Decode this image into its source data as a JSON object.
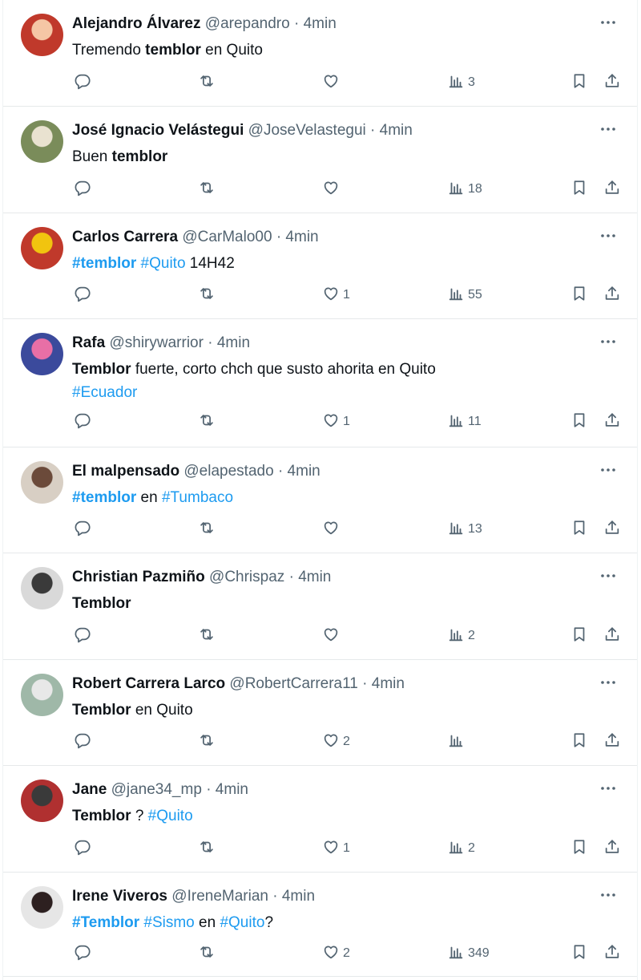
{
  "colors": {
    "accent": "#1d9bf0",
    "muted": "#536471",
    "text": "#0f1419",
    "border": "#e6e9ea"
  },
  "icons": {
    "reply": "speech-bubble-icon",
    "retweet": "retweet-arrows-icon",
    "like": "heart-icon",
    "views": "bar-chart-icon",
    "bookmark": "bookmark-icon",
    "share": "share-upload-icon",
    "more": "more-dots-icon"
  },
  "tweets": [
    {
      "name": "Alejandro Álvarez",
      "handle": "@arepandro",
      "dot": "·",
      "time": "4min",
      "text": [
        {
          "t": "Tremendo "
        },
        {
          "t": "temblor",
          "b": true
        },
        {
          "t": " en Quito"
        }
      ],
      "likes": "",
      "views": "3",
      "avatar": [
        "#c0392b",
        "#f5c6a5"
      ]
    },
    {
      "name": "José Ignacio Velástegui",
      "handle": "@JoseVelastegui",
      "dot": "·",
      "time": "4min",
      "text": [
        {
          "t": "Buen "
        },
        {
          "t": "temblor",
          "b": true
        }
      ],
      "likes": "",
      "views": "18",
      "avatar": [
        "#7a8c5a",
        "#e9e2d0"
      ]
    },
    {
      "name": "Carlos Carrera",
      "handle": "@CarMalo00",
      "dot": "·",
      "time": "4min",
      "text": [
        {
          "t": "#temblor",
          "h": true,
          "b": true
        },
        {
          "t": " "
        },
        {
          "t": "#Quito",
          "h": true
        },
        {
          "t": " 14H42"
        }
      ],
      "likes": "1",
      "views": "55",
      "avatar": [
        "#c0392b",
        "#f1c40f"
      ]
    },
    {
      "name": "Rafa",
      "handle": "@shirywarrior",
      "dot": "·",
      "time": "4min",
      "text": [
        {
          "t": "Temblor",
          "b": true
        },
        {
          "t": " fuerte, corto chch que susto ahorita en Quito "
        },
        {
          "t": "#Ecuador",
          "h": true
        }
      ],
      "likes": "1",
      "views": "11",
      "avatar": [
        "#3b4a9c",
        "#e86fa6"
      ]
    },
    {
      "name": "El malpensado",
      "handle": "@elapestado",
      "dot": "·",
      "time": "4min",
      "text": [
        {
          "t": "#temblor",
          "h": true,
          "b": true
        },
        {
          "t": " en "
        },
        {
          "t": "#Tumbaco",
          "h": true
        }
      ],
      "likes": "",
      "views": "13",
      "avatar": [
        "#d8cfc4",
        "#6b4a3a"
      ]
    },
    {
      "name": "Christian Pazmiño",
      "handle": "@Chrispaz",
      "dot": "·",
      "time": "4min",
      "text": [
        {
          "t": "Temblor",
          "b": true
        }
      ],
      "likes": "",
      "views": "2",
      "avatar": [
        "#d9d9d9",
        "#3a3a3a"
      ]
    },
    {
      "name": "Robert Carrera Larco",
      "handle": "@RobertCarrera11",
      "dot": "·",
      "time": "4min",
      "text": [
        {
          "t": "Temblor",
          "b": true
        },
        {
          "t": " en Quito"
        }
      ],
      "likes": "2",
      "views": "",
      "avatar": [
        "#9fb8a8",
        "#e8e8e8"
      ]
    },
    {
      "name": "Jane",
      "handle": "@jane34_mp",
      "dot": "·",
      "time": "4min",
      "text": [
        {
          "t": "Temblor",
          "b": true
        },
        {
          "t": " ? "
        },
        {
          "t": "#Quito",
          "h": true
        }
      ],
      "likes": "1",
      "views": "2",
      "avatar": [
        "#b03030",
        "#3a3a3a"
      ]
    },
    {
      "name": "Irene Viveros",
      "handle": "@IreneMarian",
      "dot": "·",
      "time": "4min",
      "text": [
        {
          "t": "#Temblor",
          "h": true,
          "b": true
        },
        {
          "t": " "
        },
        {
          "t": "#Sismo",
          "h": true
        },
        {
          "t": " en "
        },
        {
          "t": "#Quito",
          "h": true
        },
        {
          "t": "?"
        }
      ],
      "likes": "2",
      "views": "349",
      "avatar": [
        "#e6e6e6",
        "#2d2020"
      ]
    }
  ]
}
